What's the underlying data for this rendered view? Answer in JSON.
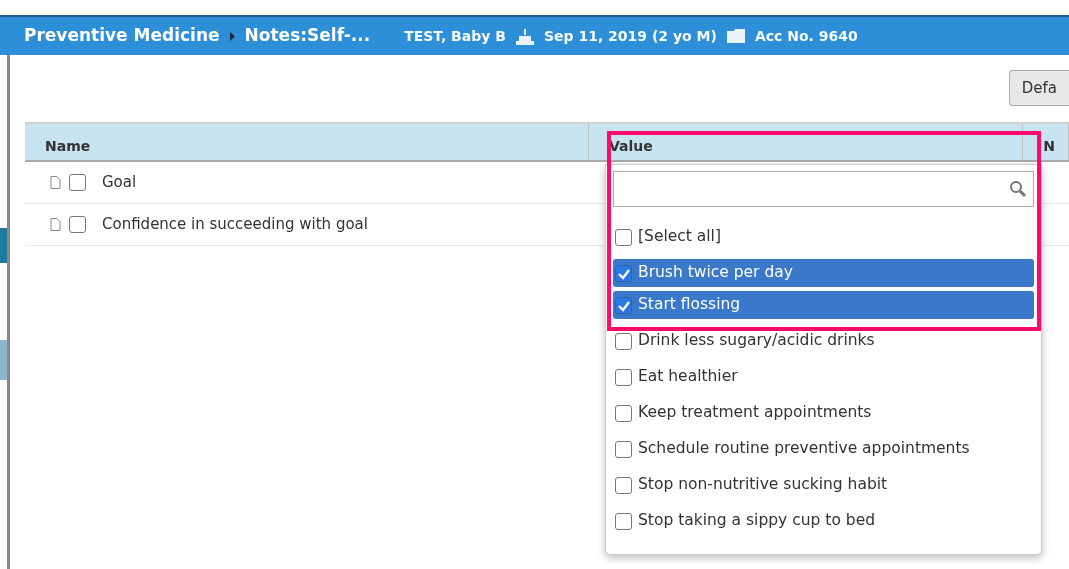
{
  "header": {
    "module": "Preventive Medicine",
    "note": "Notes:Self-...",
    "patient": "TEST, Baby B",
    "birth": "Sep 11, 2019 (2 yo M)",
    "account": "Acc No. 9640"
  },
  "toolbar": {
    "button": "Defa"
  },
  "table": {
    "columns": [
      "Name",
      "Value",
      "N"
    ],
    "rows": [
      {
        "name": "Goal",
        "checked": false
      },
      {
        "name": "Confidence in succeeding with goal",
        "checked": false
      }
    ]
  },
  "dropdown": {
    "select_all": {
      "label": "[Select all]",
      "checked": false
    },
    "options": [
      {
        "label": "Brush twice per day",
        "checked": true
      },
      {
        "label": "Start flossing",
        "checked": true
      },
      {
        "label": "Drink less sugary/acidic drinks",
        "checked": false
      },
      {
        "label": "Eat healthier",
        "checked": false
      },
      {
        "label": "Keep treatment appointments",
        "checked": false
      },
      {
        "label": "Schedule routine preventive appointments",
        "checked": false
      },
      {
        "label": "Stop non-nutritive sucking habit",
        "checked": false
      },
      {
        "label": "Stop taking a sippy cup to bed",
        "checked": false
      }
    ]
  }
}
